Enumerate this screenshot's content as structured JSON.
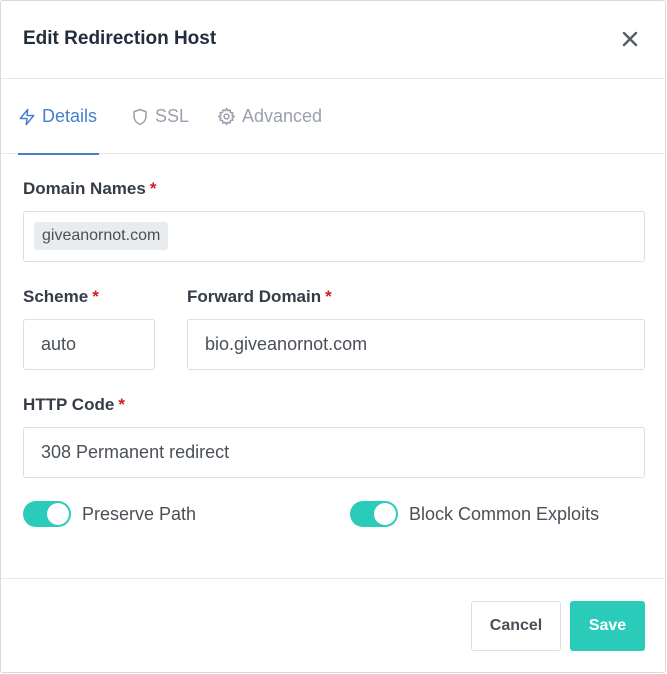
{
  "dialog": {
    "title": "Edit Redirection Host",
    "close_icon": "close-icon"
  },
  "tabs": [
    {
      "label": "Details",
      "icon": "lightning-icon",
      "active": true
    },
    {
      "label": "SSL",
      "icon": "shield-icon",
      "active": false
    },
    {
      "label": "Advanced",
      "icon": "gear-icon",
      "active": false
    }
  ],
  "form": {
    "domain_names": {
      "label": "Domain Names",
      "required_mark": "*",
      "chips": [
        "giveanornot.com"
      ]
    },
    "scheme": {
      "label": "Scheme",
      "required_mark": "*",
      "value": "auto"
    },
    "forward_domain": {
      "label": "Forward Domain",
      "required_mark": "*",
      "value": "bio.giveanornot.com"
    },
    "http_code": {
      "label": "HTTP Code",
      "required_mark": "*",
      "value": "308 Permanent redirect"
    },
    "toggles": [
      {
        "label": "Preserve Path",
        "on": true
      },
      {
        "label": "Block Common Exploits",
        "on": true
      }
    ]
  },
  "footer": {
    "cancel_label": "Cancel",
    "save_label": "Save"
  },
  "colors": {
    "accent": "#467fcf",
    "toggle_on": "#2bcbba",
    "save_button": "#2bcbba",
    "required": "#cd201f"
  }
}
